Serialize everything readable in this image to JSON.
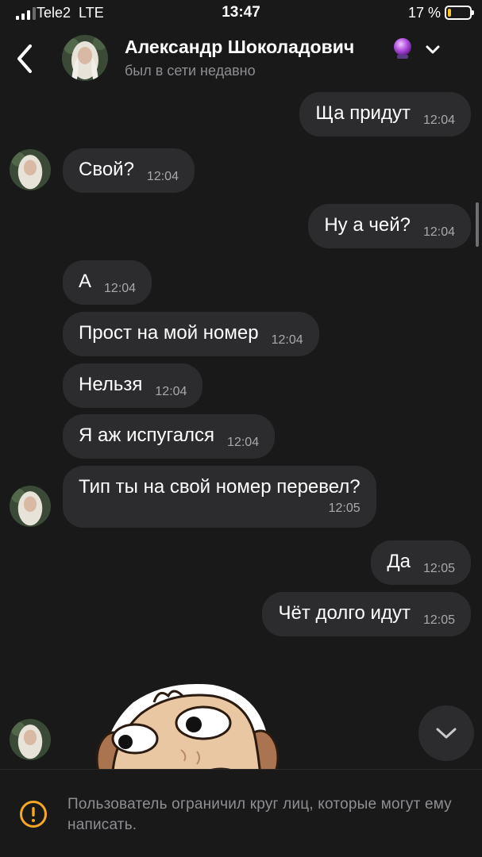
{
  "status_bar": {
    "carrier": "Tele2",
    "network": "LTE",
    "time": "13:47",
    "battery": "17 %",
    "battery_level": 0.17,
    "battery_color": "#f7c52b"
  },
  "header": {
    "back_icon": "chevron-left-icon",
    "contact_name": "Александр Шоколадович",
    "emoji": "crystal-ball",
    "status": "был в сети недавно",
    "menu_icon": "chevron-down-icon"
  },
  "messages": [
    {
      "side": "out",
      "text": "Ща придут",
      "time": "12:04"
    },
    {
      "side": "in",
      "text": "Свой?",
      "time": "12:04",
      "avatar": true
    },
    {
      "side": "out",
      "text": "Ну а чей?",
      "time": "12:04"
    },
    {
      "side": "in",
      "text": "А",
      "time": "12:04"
    },
    {
      "side": "in",
      "text": "Прост на мой номер",
      "time": "12:04"
    },
    {
      "side": "in",
      "text": "Нельзя",
      "time": "12:04"
    },
    {
      "side": "in",
      "text": "Я аж испугался",
      "time": "12:04"
    },
    {
      "side": "in",
      "text": "Тип ты на свой номер перевел?",
      "time": "12:05",
      "avatar": true
    },
    {
      "side": "out",
      "text": "Да",
      "time": "12:05"
    },
    {
      "side": "out",
      "text": "Чёт долго идут",
      "time": "12:05"
    }
  ],
  "sticker": {
    "icon": "cartoon-dog-sticker"
  },
  "scroll_down_icon": "chevron-down-icon",
  "notice": {
    "icon": "warning-icon",
    "text": "Пользователь ограничил круг лиц, которые могут ему написать."
  },
  "colors": {
    "background": "#19191a",
    "bubble": "#2c2c2e",
    "secondary_text": "#8e8e93"
  }
}
